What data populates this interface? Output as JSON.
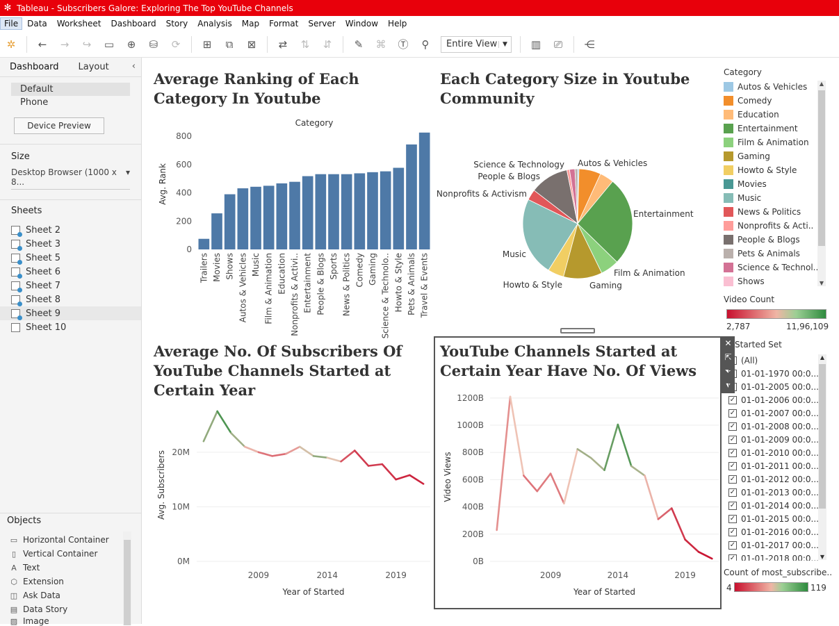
{
  "window": {
    "title": "Tableau - Subscribers Galore: Exploring The Top YouTube Channels"
  },
  "menu": [
    "File",
    "Data",
    "Worksheet",
    "Dashboard",
    "Story",
    "Analysis",
    "Map",
    "Format",
    "Server",
    "Window",
    "Help"
  ],
  "toolbar": {
    "view_mode": "Entire View"
  },
  "left_panel": {
    "tabs": [
      "Dashboard",
      "Layout"
    ],
    "devices": [
      "Default",
      "Phone"
    ],
    "device_preview_label": "Device Preview",
    "size_label": "Size",
    "size_value": "Desktop Browser (1000 x 8...",
    "sheets_label": "Sheets",
    "sheets": [
      "Sheet 2",
      "Sheet 3",
      "Sheet 5",
      "Sheet 6",
      "Sheet 7",
      "Sheet 8",
      "Sheet 9",
      "Sheet 10"
    ],
    "objects_label": "Objects",
    "objects": [
      {
        "label": "Horizontal Container",
        "icon": "horizontal-container-icon"
      },
      {
        "label": "Vertical Container",
        "icon": "vertical-container-icon"
      },
      {
        "label": "Text",
        "icon": "text-icon"
      },
      {
        "label": "Extension",
        "icon": "extension-icon"
      },
      {
        "label": "Ask Data",
        "icon": "ask-data-icon"
      },
      {
        "label": "Data Story",
        "icon": "data-story-icon"
      },
      {
        "label": "Image",
        "icon": "image-icon"
      }
    ]
  },
  "titles": {
    "bar": "Average Ranking of Each Category In Youtube",
    "pie": "Each Category Size in Youtube Community",
    "line1": "Average No. Of Subscribers Of YouTube Channels Started at Certain Year",
    "line2": "YouTube Channels Started at Certain Year Have No. Of Views"
  },
  "legend": {
    "category_title": "Category",
    "categories": [
      {
        "name": "Autos & Vehicles",
        "color": "#9dc8e4"
      },
      {
        "name": "Comedy",
        "color": "#f28e2b"
      },
      {
        "name": "Education",
        "color": "#ffbb78"
      },
      {
        "name": "Entertainment",
        "color": "#59a14f"
      },
      {
        "name": "Film & Animation",
        "color": "#8cd17d"
      },
      {
        "name": "Gaming",
        "color": "#b6992d"
      },
      {
        "name": "Howto & Style",
        "color": "#f1ce63"
      },
      {
        "name": "Movies",
        "color": "#499894"
      },
      {
        "name": "Music",
        "color": "#86bcb6"
      },
      {
        "name": "News & Politics",
        "color": "#e15759"
      },
      {
        "name": "Nonprofits & Acti..",
        "color": "#ff9d9a"
      },
      {
        "name": "People & Blogs",
        "color": "#79706e"
      },
      {
        "name": "Pets & Animals",
        "color": "#bab0ac"
      },
      {
        "name": "Science & Technol..",
        "color": "#d37295"
      },
      {
        "name": "Shows",
        "color": "#fabfd2"
      }
    ],
    "video_count_title": "Video Count",
    "video_count_min": "2,787",
    "video_count_max": "11,96,109",
    "started_set_title": "Started Set",
    "started_set_items": [
      {
        "label": "(All)",
        "checked": false
      },
      {
        "label": "01-01-1970 00:0...",
        "checked": false
      },
      {
        "label": "01-01-2005 00:0...",
        "checked": false
      },
      {
        "label": "01-01-2006 00:0...",
        "checked": true
      },
      {
        "label": "01-01-2007 00:0...",
        "checked": true
      },
      {
        "label": "01-01-2008 00:0...",
        "checked": true
      },
      {
        "label": "01-01-2009 00:0...",
        "checked": true
      },
      {
        "label": "01-01-2010 00:0...",
        "checked": true
      },
      {
        "label": "01-01-2011 00:0...",
        "checked": true
      },
      {
        "label": "01-01-2012 00:0...",
        "checked": true
      },
      {
        "label": "01-01-2013 00:0...",
        "checked": true
      },
      {
        "label": "01-01-2014 00:0...",
        "checked": true
      },
      {
        "label": "01-01-2015 00:0...",
        "checked": true
      },
      {
        "label": "01-01-2016 00:0...",
        "checked": true
      },
      {
        "label": "01-01-2017 00:0...",
        "checked": true
      },
      {
        "label": "01-01-2018 00:0...",
        "checked": true
      }
    ],
    "count_title": "Count of most_subscribe..",
    "count_min": "4",
    "count_max": "119",
    "colors": {
      "low": "#c8102e",
      "high": "#2e8b3e"
    }
  },
  "chart_data": [
    {
      "type": "bar",
      "title": "Average Ranking of Each Category In Youtube",
      "header": "Category",
      "ylabel": "Avg. Rank",
      "ylim": [
        0,
        830
      ],
      "yticks": [
        0,
        200,
        400,
        600,
        800
      ],
      "categories": [
        "Trailers",
        "Movies",
        "Shows",
        "Autos & Vehicles",
        "Music",
        "Film & Animation",
        "Education",
        "Nonprofits & Activi..",
        "Entertainment",
        "People & Blogs",
        "Sports",
        "News & Politics",
        "Comedy",
        "Gaming",
        "Science & Technolo..",
        "Howto & Style",
        "Pets & Animals",
        "Travel & Events"
      ],
      "values": [
        75,
        255,
        390,
        432,
        443,
        450,
        467,
        478,
        518,
        532,
        532,
        532,
        538,
        546,
        552,
        577,
        742,
        826
      ],
      "bar_color": "#4e79a7"
    },
    {
      "type": "pie",
      "title": "Each Category Size in Youtube Community",
      "labels": [
        "Autos & Vehicles",
        "Entertainment",
        "Film & Animation",
        "Gaming",
        "Howto & Style",
        "Music",
        "Nonprofits & Activism",
        "People & Blogs",
        "Science & Technology"
      ],
      "slices": [
        {
          "name": "Autos & Vehicles",
          "value": 0.4,
          "color": "#9dc8e4"
        },
        {
          "name": "Comedy",
          "value": 6.5,
          "color": "#f28e2b"
        },
        {
          "name": "Education",
          "value": 4.2,
          "color": "#ffbb78"
        },
        {
          "name": "Entertainment",
          "value": 26.5,
          "color": "#59a14f"
        },
        {
          "name": "Film & Animation",
          "value": 5.5,
          "color": "#8cd17d"
        },
        {
          "name": "Gaming",
          "value": 11.5,
          "color": "#b6992d"
        },
        {
          "name": "Howto & Style",
          "value": 4.8,
          "color": "#f1ce63"
        },
        {
          "name": "Music",
          "value": 23.5,
          "color": "#86bcb6"
        },
        {
          "name": "News & Politics",
          "value": 3.2,
          "color": "#e15759"
        },
        {
          "name": "People & Blogs",
          "value": 11.5,
          "color": "#79706e"
        },
        {
          "name": "Nonprofits & Activism",
          "value": 0.8,
          "color": "#ff9d9a"
        },
        {
          "name": "Science & Technology",
          "value": 1.6,
          "color": "#d37295"
        },
        {
          "name": "Pets & Animals",
          "value": 0.8,
          "color": "#bab0ac"
        }
      ]
    },
    {
      "type": "line",
      "title": "Average No. Of Subscribers Of YouTube Channels Started at Certain Year",
      "xlabel": "Year of Started",
      "ylabel": "Avg. Subscribers",
      "xlim": [
        2004.5,
        2021.5
      ],
      "xticks": [
        2009,
        2014,
        2019
      ],
      "ylim": [
        0,
        28
      ],
      "yticks": [
        {
          "v": 0,
          "label": "0M"
        },
        {
          "v": 10,
          "label": "10M"
        },
        {
          "v": 20,
          "label": "20M"
        }
      ],
      "x": [
        2005,
        2006,
        2007,
        2008,
        2009,
        2010,
        2011,
        2012,
        2013,
        2014,
        2015,
        2016,
        2017,
        2018,
        2019,
        2020,
        2021
      ],
      "y": [
        22,
        27.5,
        23.5,
        21,
        20,
        19.3,
        19.7,
        21,
        19.3,
        19,
        18.3,
        20.3,
        17.5,
        17.8,
        15,
        15.8,
        14.2
      ],
      "count": [
        60,
        119,
        100,
        70,
        40,
        30,
        35,
        60,
        80,
        100,
        30,
        20,
        15,
        20,
        10,
        12,
        8
      ]
    },
    {
      "type": "line",
      "title": "YouTube Channels Started at Certain Year Have No. Of Views",
      "xlabel": "Year of Started",
      "ylabel": "Video Views",
      "xlim": [
        2004.5,
        2021.5
      ],
      "xticks": [
        2009,
        2014,
        2019
      ],
      "ylim": [
        0,
        1240
      ],
      "yticks": [
        {
          "v": 0,
          "label": "0B"
        },
        {
          "v": 200,
          "label": "200B"
        },
        {
          "v": 400,
          "label": "400B"
        },
        {
          "v": 600,
          "label": "600B"
        },
        {
          "v": 800,
          "label": "800B"
        },
        {
          "v": 1000,
          "label": "1000B"
        },
        {
          "v": 1200,
          "label": "1200B"
        }
      ],
      "x": [
        2005,
        2006,
        2007,
        2008,
        2009,
        2010,
        2011,
        2012,
        2013,
        2014,
        2015,
        2016,
        2017,
        2018,
        2019,
        2020,
        2021
      ],
      "y": [
        230,
        1210,
        630,
        515,
        645,
        425,
        825,
        760,
        670,
        1005,
        700,
        630,
        310,
        390,
        160,
        70,
        20
      ],
      "count": [
        8,
        80,
        40,
        30,
        45,
        30,
        90,
        80,
        85,
        119,
        95,
        70,
        40,
        20,
        15,
        8,
        4
      ]
    }
  ]
}
